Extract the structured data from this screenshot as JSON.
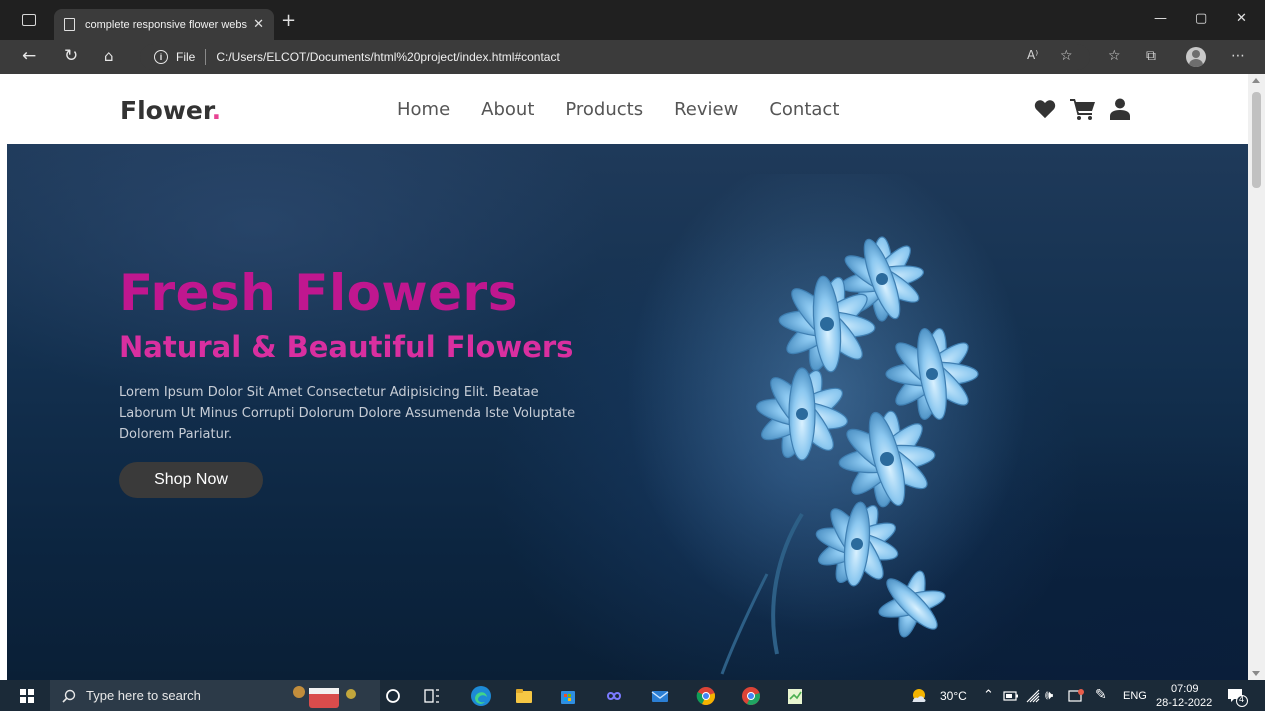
{
  "browser": {
    "tab_title": "complete responsive flower webs",
    "tab_close": "✕",
    "new_tab": "+",
    "address_label": "File",
    "url": "C:/Users/ELCOT/Documents/html%20project/index.html#contact",
    "read_aloud": "A⁾",
    "more": "⋯"
  },
  "site": {
    "logo_text": "Flower",
    "logo_dot": ".",
    "nav": [
      "Home",
      "About",
      "Products",
      "Review",
      "Contact"
    ],
    "icons": [
      "heart-icon",
      "cart-icon",
      "user-icon"
    ]
  },
  "hero": {
    "title": "Fresh Flowers",
    "subtitle": "Natural & Beautiful Flowers",
    "text": "Lorem Ipsum Dolor Sit Amet Consectetur Adipisicing Elit. Beatae Laborum Ut Minus Corrupti Dolorum Dolore Assumenda Iste Voluptate Dolorem Pariatur.",
    "button": "Shop Now"
  },
  "taskbar": {
    "search_placeholder": "Type here to search",
    "temperature": "30°C",
    "language": "ENG",
    "time": "07:09",
    "date": "28-12-2022",
    "notifications": "4"
  },
  "colors": {
    "accent_pink": "#e84393",
    "hero_title": "#c0178f"
  }
}
